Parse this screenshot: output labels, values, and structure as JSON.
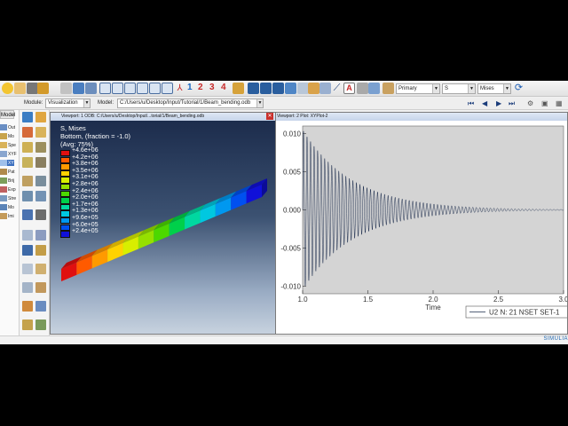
{
  "colors": {
    "accent": "#1f5fb4",
    "viewport_bg_top": "#1c2c4c",
    "viewport_bg_bottom": "#c9d4e0",
    "plot_bg": "#d4d4d4",
    "curve": "#1c2c4c"
  },
  "toolbar": {
    "set_numbers": [
      "1",
      "2",
      "3",
      "4"
    ],
    "set_colors": [
      "#1565c0",
      "#c62828",
      "#c62828",
      "#c62828"
    ],
    "text_tool_label": "A",
    "variable_type": "Primary",
    "component": "S",
    "invariant": "Mises"
  },
  "context": {
    "module_label": "Module:",
    "module_value": "Visualization",
    "model_label": "Model:",
    "model_value": "C:/Users/u/Desktop/Input/Tutorial/1/Beam_bending.odb"
  },
  "model_tree": {
    "tab_label": "Model",
    "items": [
      "Out",
      "Mo",
      "Spe",
      "XYF",
      "XY",
      "Pat",
      "Brij",
      "Exp",
      "Stre",
      "Mo",
      "Imi"
    ]
  },
  "viewport1": {
    "title": "Viewport: 1    ODB: C:/Users/u/Desktop/Input/...torial/1/Beam_bending.odb",
    "legend": {
      "header": [
        "S, Mises",
        "Bottom, (fraction = -1.0)",
        "(Avg: 75%)"
      ],
      "values": [
        "+4.6e+06",
        "+4.2e+06",
        "+3.8e+06",
        "+3.5e+06",
        "+3.1e+06",
        "+2.8e+06",
        "+2.4e+06",
        "+2.0e+06",
        "+1.7e+06",
        "+1.3e+06",
        "+9.6e+05",
        "+6.0e+05",
        "+2.4e+05"
      ],
      "colors": [
        "#e01010",
        "#ff5a00",
        "#ff9a00",
        "#ffd200",
        "#d8ee00",
        "#96e000",
        "#4cd800",
        "#00d04a",
        "#00d8a0",
        "#00c8e0",
        "#0098f0",
        "#0050f0",
        "#1010d8"
      ]
    },
    "beam_segment_colors": [
      "#e01010",
      "#ff5a00",
      "#ff9a00",
      "#ffd200",
      "#d8ee00",
      "#96e000",
      "#4cd800",
      "#00d04a",
      "#00d8a0",
      "#00c8e0",
      "#0098f0",
      "#0050f0",
      "#1010d8"
    ]
  },
  "viewport2": {
    "title": "Viewport: 2    Plot: XYPlot-2",
    "xlabel": "Time",
    "legend_entry": "U2 N: 21 NSET SET-1"
  },
  "chart_data": {
    "type": "line",
    "title": "",
    "xlabel": "Time",
    "ylabel": "",
    "xlim": [
      1.0,
      3.0
    ],
    "ylim": [
      -0.011,
      0.011
    ],
    "x_ticks": [
      "1.0",
      "1.5",
      "2.0",
      "2.5",
      "3.0"
    ],
    "y_ticks": [
      "0.010",
      "0.005",
      "0.000",
      "-0.005",
      "-0.010"
    ],
    "y_tick_values": [
      0.01,
      0.005,
      0.0,
      -0.005,
      -0.01
    ],
    "grid": false,
    "legend_position": "bottom-right",
    "series": [
      {
        "name": "U2 N: 21 NSET SET-1",
        "x_start": 1.0,
        "x_end": 3.0,
        "initial_amplitude": 0.0105,
        "decay_rate": 2.6,
        "frequency_hz": 37
      }
    ]
  },
  "status": {
    "brand": "SIMULIA"
  }
}
